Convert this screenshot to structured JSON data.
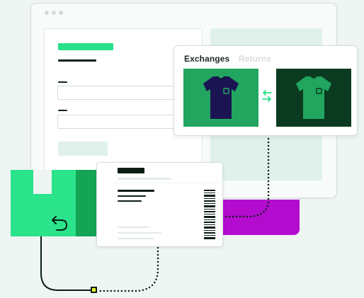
{
  "tabs": {
    "exchanges_label": "Exchanges",
    "returns_label": "Returns"
  },
  "colors": {
    "page_background": "#eef5f3",
    "brand_green": "#2be38a",
    "dark_green": "#0a3b20",
    "mid_green": "#21a55f",
    "navy": "#1b1453",
    "purple": "#b30ccf"
  },
  "icons": {
    "swap": "swap-arrows-icon",
    "return": "return-arrow-icon",
    "shirt_left": "tshirt-icon",
    "shirt_right": "tshirt-icon",
    "barcode": "barcode-icon"
  }
}
